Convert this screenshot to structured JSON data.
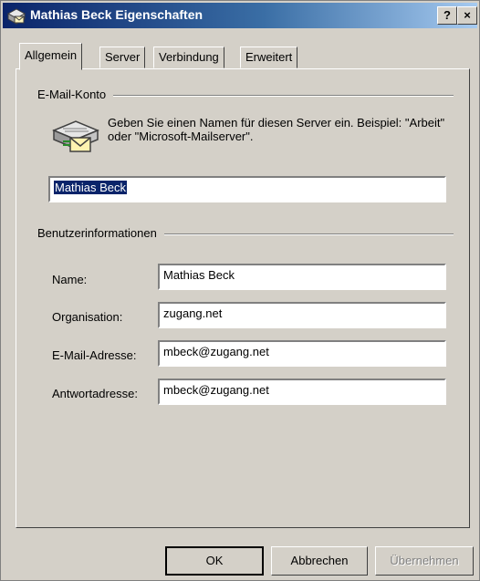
{
  "window": {
    "title": "Mathias Beck Eigenschaften",
    "help_label": "?",
    "close_label": "×"
  },
  "tabs": [
    {
      "label": "Allgemein",
      "active": true
    },
    {
      "label": "Server",
      "active": false
    },
    {
      "label": "Verbindung",
      "active": false
    },
    {
      "label": "Erweitert",
      "active": false
    }
  ],
  "mail_account": {
    "group_label": "E-Mail-Konto",
    "description": "Geben Sie einen Namen für diesen Server ein. Beispiel: \"Arbeit\" oder \"Microsoft-Mailserver\".",
    "account_name": "Mathias Beck"
  },
  "user_info": {
    "group_label": "Benutzerinformationen",
    "fields": [
      {
        "label": "Name:",
        "value": "Mathias Beck"
      },
      {
        "label": "Organisation:",
        "value": "zugang.net"
      },
      {
        "label": "E-Mail-Adresse:",
        "value": "mbeck@zugang.net"
      },
      {
        "label": "Antwortadresse:",
        "value": "mbeck@zugang.net"
      }
    ]
  },
  "buttons": {
    "ok": "OK",
    "cancel": "Abbrechen",
    "apply": "Übernehmen"
  }
}
